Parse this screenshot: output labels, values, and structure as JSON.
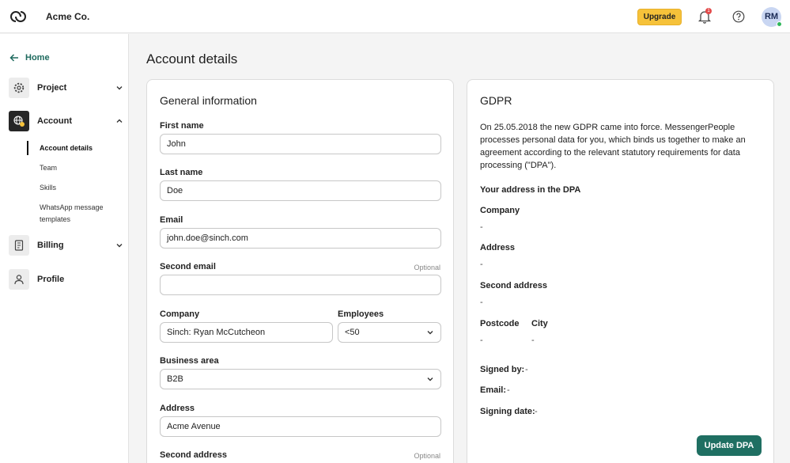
{
  "header": {
    "company": "Acme Co.",
    "upgrade_label": "Upgrade",
    "notification_count": "1",
    "avatar_initials": "RM",
    "colors": {
      "upgrade": "#f6c23a",
      "accent": "#1f6f62"
    }
  },
  "sidebar": {
    "home_label": "Home",
    "project_label": "Project",
    "account_label": "Account",
    "account_items": [
      "Account details",
      "Team",
      "Skills",
      "WhatsApp message templates"
    ],
    "billing_label": "Billing",
    "profile_label": "Profile"
  },
  "page": {
    "title": "Account details"
  },
  "general": {
    "title": "General information",
    "optional_label": "Optional",
    "first_name": {
      "label": "First name",
      "value": "John"
    },
    "last_name": {
      "label": "Last name",
      "value": "Doe"
    },
    "email": {
      "label": "Email",
      "value": "john.doe@sinch.com"
    },
    "second_email": {
      "label": "Second email",
      "value": ""
    },
    "company": {
      "label": "Company",
      "value": "Sinch: Ryan McCutcheon"
    },
    "employees": {
      "label": "Employees",
      "value": "<50"
    },
    "business_area": {
      "label": "Business area",
      "value": "B2B"
    },
    "address": {
      "label": "Address",
      "value": "Acme Avenue"
    },
    "second_address": {
      "label": "Second address"
    }
  },
  "gdpr": {
    "title": "GDPR",
    "text": "On 25.05.2018 the new GDPR came into force. MessengerPeople processes personal data for you, which binds us together to make an agreement according to the relevant statutory requirements for data processing (\"DPA\").",
    "address_heading": "Your address in the DPA",
    "company_label": "Company",
    "company_value": "-",
    "address_label": "Address",
    "address_value": "-",
    "second_address_label": "Second address",
    "second_address_value": "-",
    "postcode_label": "Postcode",
    "postcode_value": "-",
    "city_label": "City",
    "city_value": "-",
    "signed_by_label": "Signed by:",
    "signed_by_value": "-",
    "email_label": "Email:",
    "email_value": "-",
    "signing_date_label": "Signing date:",
    "signing_date_value": "-",
    "update_label": "Update DPA"
  }
}
